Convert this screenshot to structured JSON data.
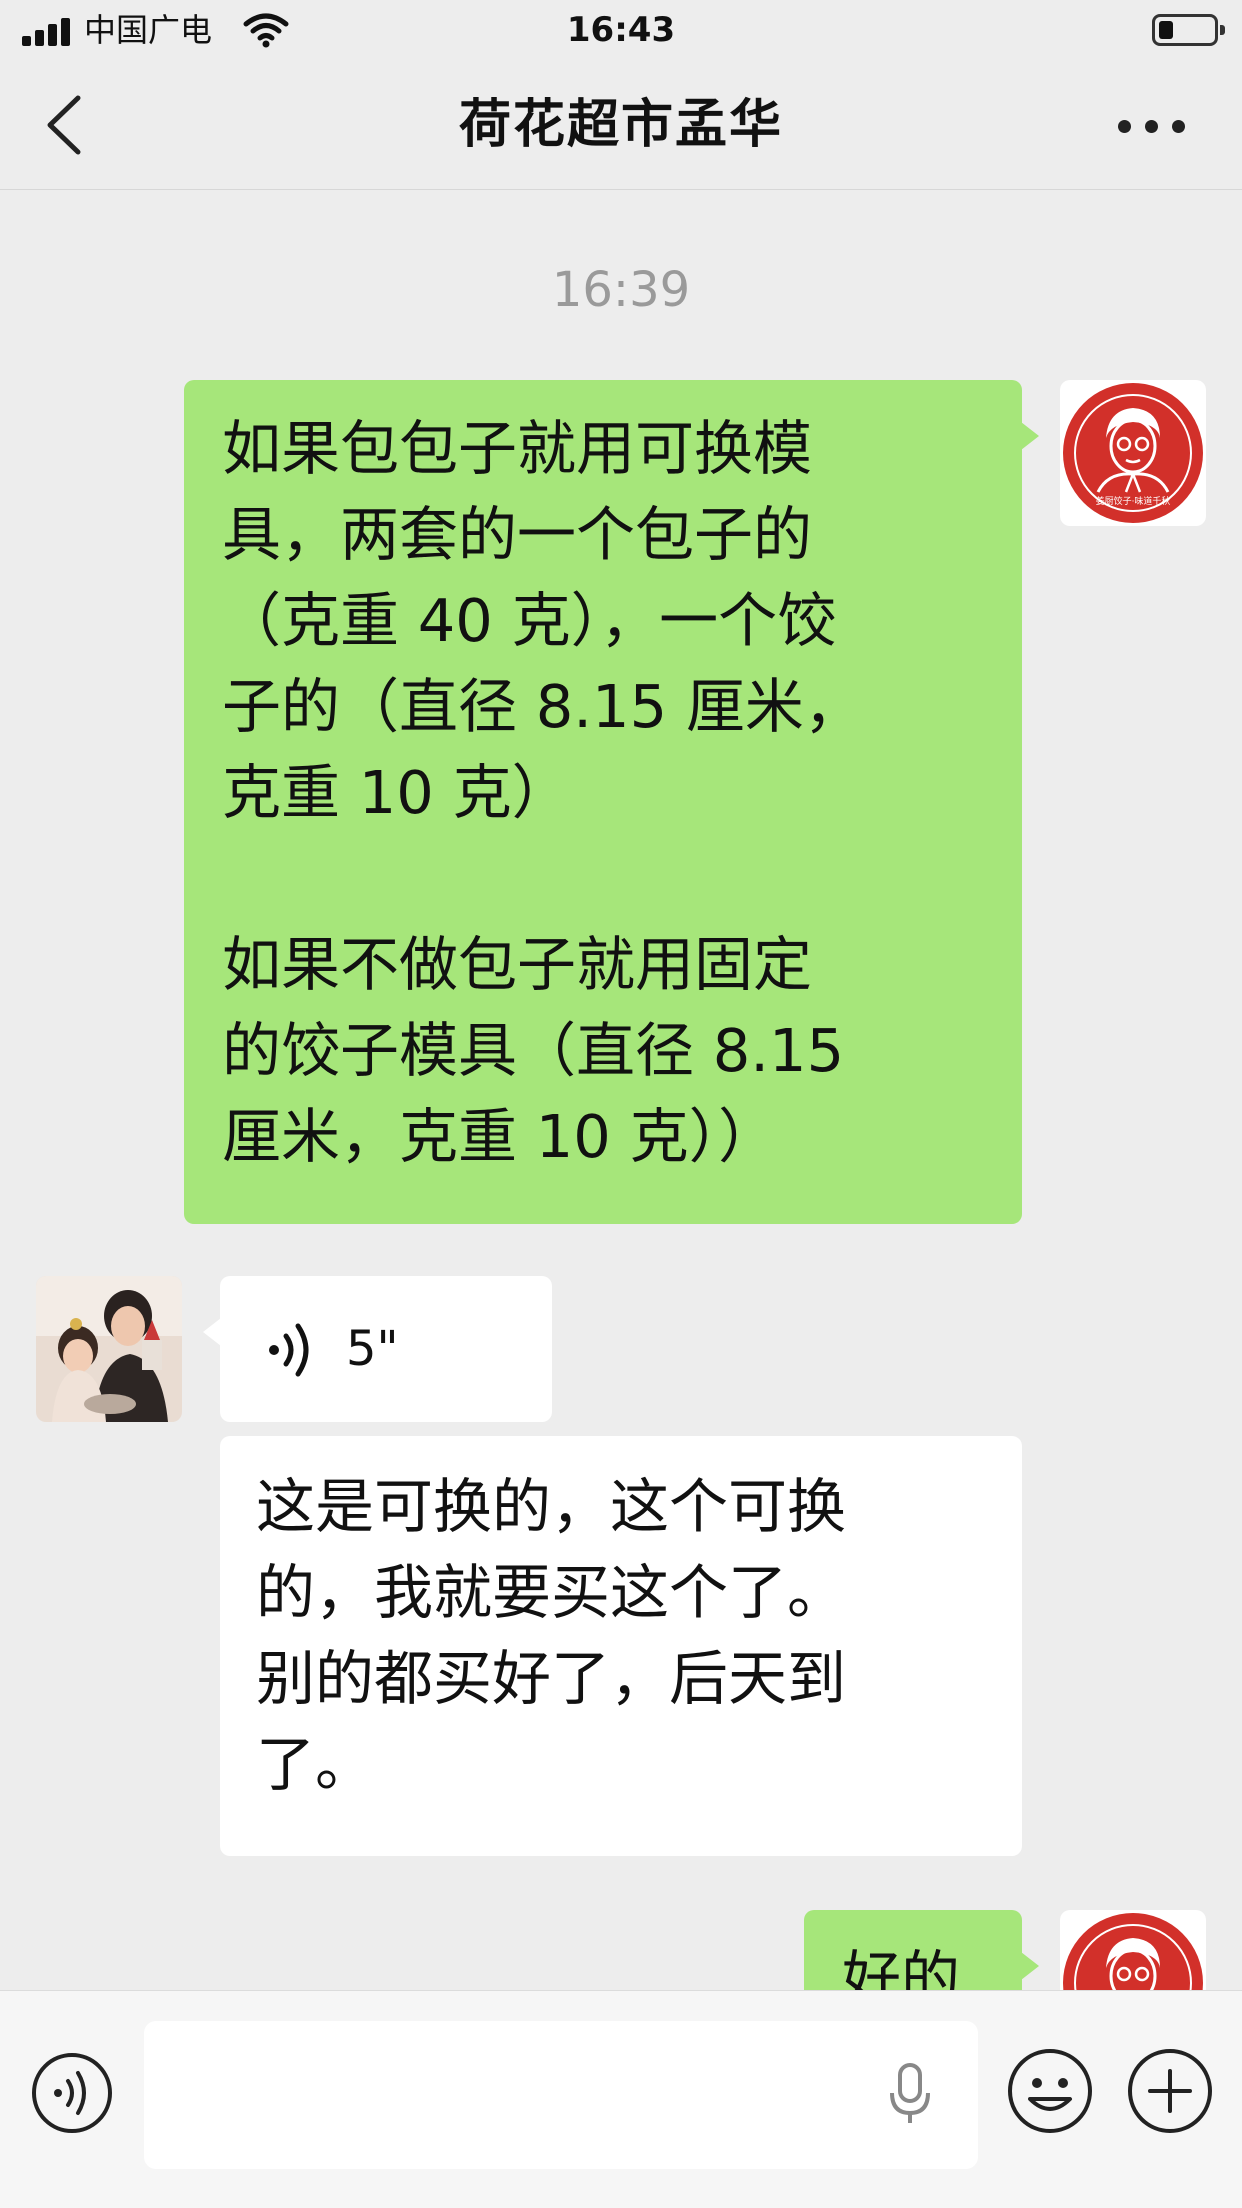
{
  "status_bar": {
    "carrier": "中国广电",
    "time": "16:43"
  },
  "header": {
    "title": "荷花超市孟华",
    "back_icon": "chevron-left-icon",
    "more_icon": "more-dots-icon"
  },
  "chat": {
    "timestamp": "16:39",
    "messages": [
      {
        "side": "me",
        "type": "text",
        "text": "如果包包子就用可换模\n具，两套的一个包子的\n（克重 40 克），一个饺\n子的（直径 8.15 厘米，\n克重 10 克）\n\n如果不做包子就用固定\n的饺子模具（直径 8.15\n厘米，克重 10 克））"
      },
      {
        "side": "other",
        "type": "voice",
        "duration": "5\""
      },
      {
        "side": "other",
        "type": "text",
        "text": "这是可换的，这个可换\n的，我就要买这个了。\n别的都买好了，后天到\n了。"
      },
      {
        "side": "me",
        "type": "text",
        "text": "好的"
      }
    ],
    "avatar_me_logo_text": "姜厨饺子·味道千秋"
  },
  "input_bar": {
    "voice_icon": "voice-toggle-icon",
    "mic_icon": "microphone-icon",
    "emoji_icon": "emoji-icon",
    "plus_icon": "plus-icon"
  },
  "colors": {
    "background": "#ededed",
    "my_bubble": "#a6e67a",
    "other_bubble": "#ffffff",
    "logo_red": "#d2302a"
  }
}
